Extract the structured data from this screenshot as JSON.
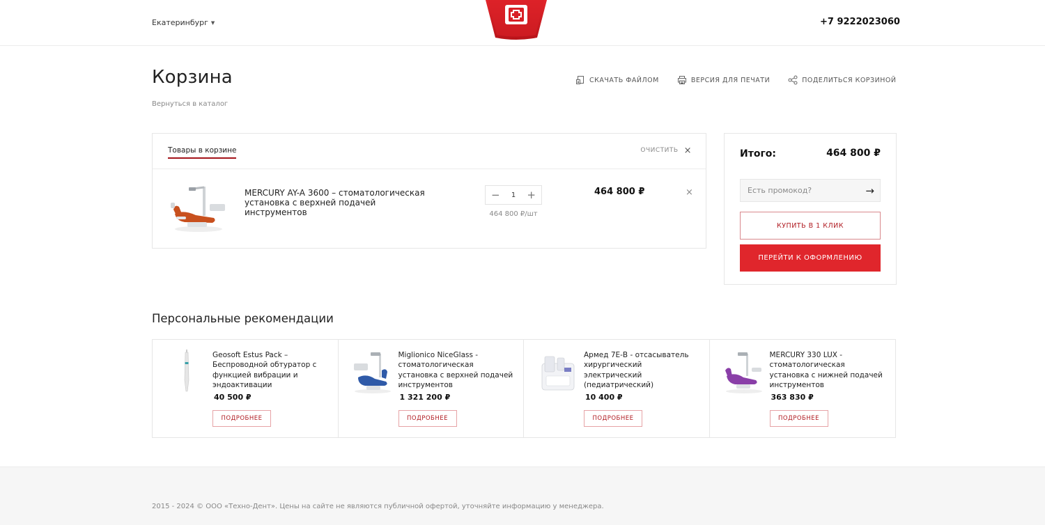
{
  "header": {
    "city": "Екатеринбург",
    "phone": "+7 9222023060",
    "brand_color": "#e0262c"
  },
  "page": {
    "title": "Корзина",
    "back_link": "Вернуться в каталог",
    "actions": [
      {
        "label": "Скачать файлом",
        "icon": "file-download-icon"
      },
      {
        "label": "Версия для печати",
        "icon": "printer-icon"
      },
      {
        "label": "Поделиться корзиной",
        "icon": "share-icon"
      }
    ]
  },
  "basket": {
    "tab_label": "Товары в корзине",
    "clear_label": "Очистить",
    "items": [
      {
        "name": "MERCURY AY-A 3600 – стоматологическая установка с верхней подачей инструментов",
        "quantity": "1",
        "unit_price": "464 800 ₽/шт",
        "price": "464 800 ₽"
      }
    ]
  },
  "summary": {
    "total_label": "Итого:",
    "total_value": "464 800 ₽",
    "promo_placeholder": "Есть промокод?",
    "one_click_label": "Купить в 1 клик",
    "checkout_label": "Перейти к оформлению"
  },
  "recommendations": {
    "title": "Персональные рекомендации",
    "button_label": "Подробнее",
    "items": [
      {
        "name": "Geosoft Estus Pack – Беспроводной обтуратор с функцией вибрации и эндоактивации",
        "price": "40 500 ₽"
      },
      {
        "name": "Miglionico NiceGlass - стоматологическая установка с верхней подачей инструментов",
        "price": "1 321 200 ₽"
      },
      {
        "name": "Армед 7Е-В - отсасыватель хирургический электрический (педиатрический)",
        "price": "10 400 ₽"
      },
      {
        "name": "MERCURY 330 LUX - стоматологическая установка с нижней подачей инструментов",
        "price": "363 830 ₽"
      }
    ]
  },
  "footer": {
    "copyright": "2015 - 2024 © ООО «Техно-Дент». Цены на сайте не являются публичной офертой, уточняйте информацию у менеджера."
  }
}
